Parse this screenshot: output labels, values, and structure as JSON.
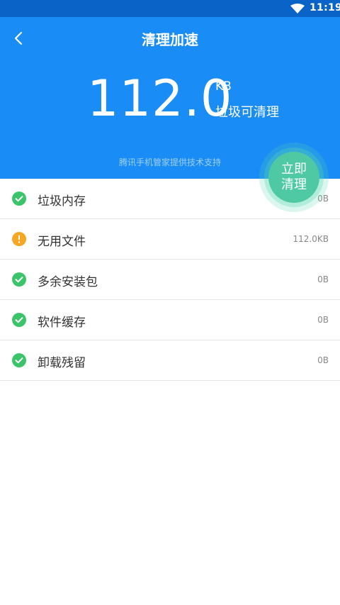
{
  "status_bar": {
    "time": "11:19",
    "wifi_icon": "wifi-icon"
  },
  "header": {
    "title": "清理加速",
    "back_icon": "back-arrow-icon",
    "junk_size_value": "112.0",
    "junk_size_unit": "KB",
    "junk_size_label": "垃圾可清理",
    "provider_text": "腾讯手机管家提供技术支持",
    "background_color": "#1a8cf5"
  },
  "clean_button": {
    "line1": "立即",
    "line2": "清理",
    "color": "#4ec9a3"
  },
  "items": [
    {
      "label": "垃圾内存",
      "size": "0B",
      "status": "ok"
    },
    {
      "label": "无用文件",
      "size": "112.0KB",
      "status": "warning"
    },
    {
      "label": "多余安装包",
      "size": "0B",
      "status": "ok"
    },
    {
      "label": "软件缓存",
      "size": "0B",
      "status": "ok"
    },
    {
      "label": "卸载残留",
      "size": "0B",
      "status": "ok"
    }
  ],
  "status_colors": {
    "ok": "#3cc46a",
    "warning": "#f5a623"
  }
}
